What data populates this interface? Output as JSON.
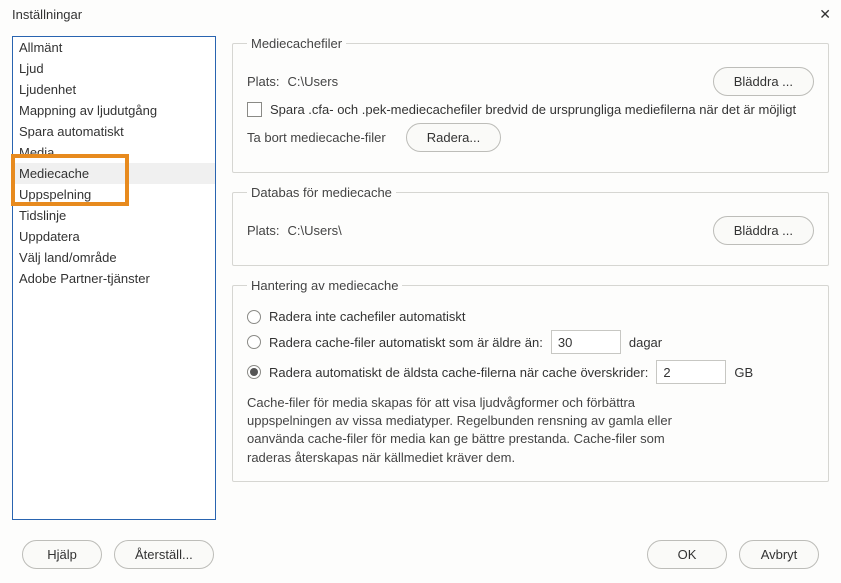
{
  "window": {
    "title": "Inställningar"
  },
  "sidebar": {
    "items": [
      {
        "label": "Allmänt"
      },
      {
        "label": "Ljud"
      },
      {
        "label": "Ljudenhet"
      },
      {
        "label": "Mappning av ljudutgång"
      },
      {
        "label": "Spara automatiskt"
      },
      {
        "label": "Media"
      },
      {
        "label": "Mediecache"
      },
      {
        "label": "Uppspelning"
      },
      {
        "label": "Tidslinje"
      },
      {
        "label": "Uppdatera"
      },
      {
        "label": "Välj land/område"
      },
      {
        "label": "Adobe Partner-tjänster"
      }
    ],
    "selected_index": 6
  },
  "panels": {
    "mediaCacheFiles": {
      "legend": "Mediecachefiler",
      "location_label": "Plats:",
      "location_path": "C:\\Users",
      "browse_label": "Bläddra ...",
      "save_beside_label": "Spara .cfa- och .pek-mediecachefiler bredvid de ursprungliga mediefilerna när det är möjligt",
      "remove_label": "Ta bort mediecache-filer",
      "delete_button": "Radera..."
    },
    "mediaCacheDb": {
      "legend": "Databas för mediecache",
      "location_label": "Plats:",
      "location_path": "C:\\Users\\",
      "browse_label": "Bläddra ..."
    },
    "cacheMgmt": {
      "legend": "Hantering av mediecache",
      "opt_none": "Radera inte cachefiler automatiskt",
      "opt_age_prefix": "Radera cache-filer automatiskt som är äldre än:",
      "age_value": "30",
      "age_unit": "dagar",
      "opt_size_prefix": "Radera automatiskt de äldsta cache-filerna när cache överskrider:",
      "size_value": "2",
      "size_unit": "GB",
      "selected": "size",
      "help_text": "Cache-filer för media skapas för att visa ljudvågformer och förbättra uppspelningen av vissa mediatyper. Regelbunden rensning av gamla eller oanvända cache-filer för media kan ge bättre prestanda. Cache-filer som raderas återskapas när källmediet kräver dem."
    }
  },
  "footer": {
    "help": "Hjälp",
    "reset": "Återställ...",
    "ok": "OK",
    "cancel": "Avbryt"
  }
}
